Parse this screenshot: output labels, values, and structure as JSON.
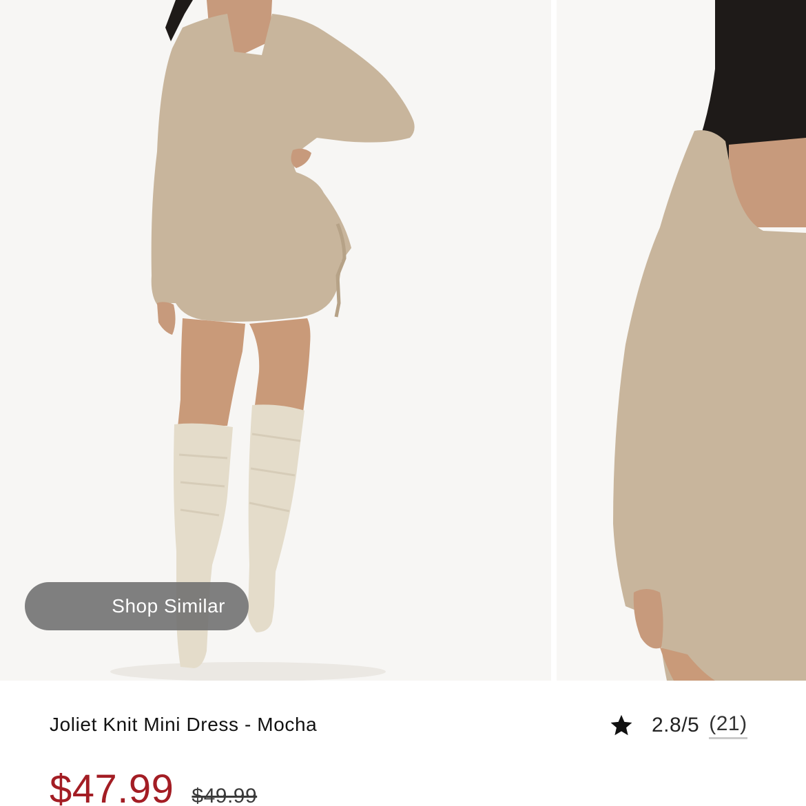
{
  "gallery": {
    "images": [
      {
        "name": "model-full-length",
        "alt": "Model wearing knit mini dress with knee-high boots"
      },
      {
        "name": "model-closeup",
        "alt": "Close-up of knit mini dress"
      }
    ],
    "shop_similar_label": "Shop Similar"
  },
  "product": {
    "name": "Joliet Knit Mini Dress - Mocha",
    "rating": {
      "icon": "star-icon",
      "score": "2.8/5",
      "count": "(21)"
    },
    "price": {
      "sale": "$47.99",
      "original": "$49.99",
      "sale_color": "#a31d24"
    }
  },
  "colors": {
    "background": "#ffffff",
    "photo_background": "#f7f6f4",
    "dress": "#c8b59c",
    "boots": "#e4dcca",
    "button_overlay": "#6e6e6e"
  }
}
